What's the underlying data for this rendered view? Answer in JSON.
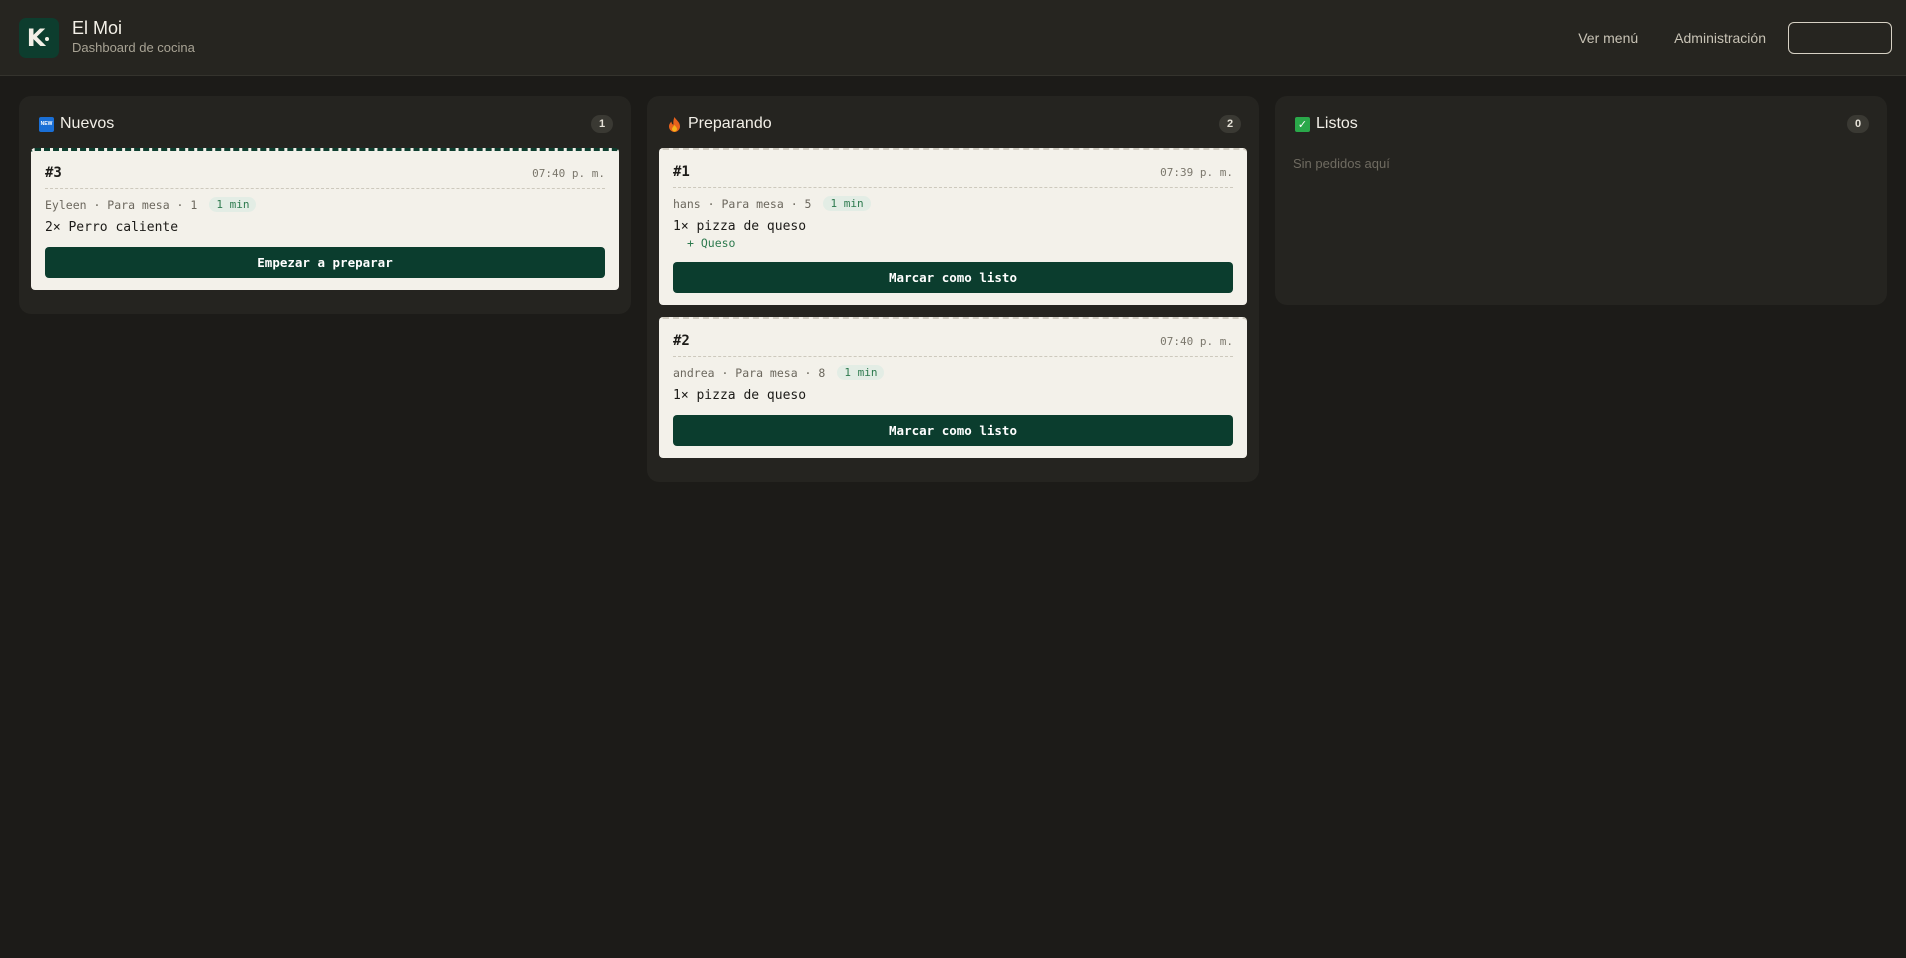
{
  "header": {
    "logo_letter": "K",
    "title": "El Moi",
    "subtitle": "Dashboard de cocina",
    "nav": {
      "menu_label": "Ver menú",
      "admin_label": "Administración"
    }
  },
  "columns": {
    "nuevos": {
      "icon": "new-icon",
      "icon_text": "NEW",
      "title": "Nuevos",
      "count": "1",
      "orders": [
        {
          "number": "#3",
          "time": "07:40 p. m.",
          "meta": "Eyleen · Para mesa · 1",
          "wait": "1 min",
          "items": [
            "2× Perro caliente"
          ],
          "action": "Empezar a preparar"
        }
      ]
    },
    "preparando": {
      "icon": "fire-icon",
      "title": "Preparando",
      "count": "2",
      "orders": [
        {
          "number": "#1",
          "time": "07:39 p. m.",
          "meta": "hans · Para mesa · 5",
          "wait": "1 min",
          "items": [
            "1× pizza de queso"
          ],
          "extras": [
            "+ Queso"
          ],
          "action": "Marcar como listo"
        },
        {
          "number": "#2",
          "time": "07:40 p. m.",
          "meta": "andrea · Para mesa · 8",
          "wait": "1 min",
          "items": [
            "1× pizza de queso"
          ],
          "action": "Marcar como listo"
        }
      ]
    },
    "listos": {
      "icon": "check-icon",
      "icon_text": "✓",
      "title": "Listos",
      "count": "0",
      "empty_text": "Sin pedidos aquí"
    }
  },
  "colors": {
    "background": "#1c1b18",
    "panel": "#252420",
    "card": "#f3f1ea",
    "accent": "#0b3d2e",
    "wait_green": "#2d7a4e"
  }
}
